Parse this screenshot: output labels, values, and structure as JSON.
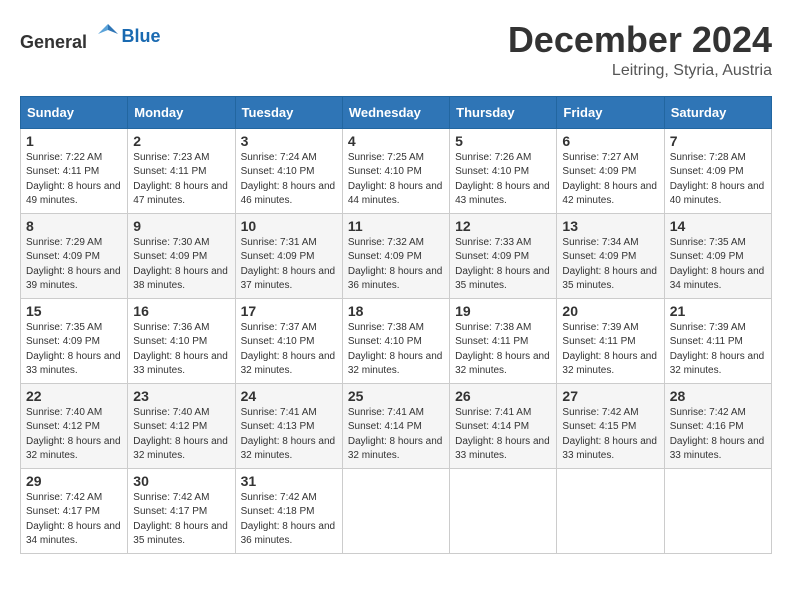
{
  "header": {
    "logo_general": "General",
    "logo_blue": "Blue",
    "month": "December 2024",
    "location": "Leitring, Styria, Austria"
  },
  "weekdays": [
    "Sunday",
    "Monday",
    "Tuesday",
    "Wednesday",
    "Thursday",
    "Friday",
    "Saturday"
  ],
  "weeks": [
    [
      {
        "day": "1",
        "sunrise": "7:22 AM",
        "sunset": "4:11 PM",
        "daylight": "8 hours and 49 minutes."
      },
      {
        "day": "2",
        "sunrise": "7:23 AM",
        "sunset": "4:11 PM",
        "daylight": "8 hours and 47 minutes."
      },
      {
        "day": "3",
        "sunrise": "7:24 AM",
        "sunset": "4:10 PM",
        "daylight": "8 hours and 46 minutes."
      },
      {
        "day": "4",
        "sunrise": "7:25 AM",
        "sunset": "4:10 PM",
        "daylight": "8 hours and 44 minutes."
      },
      {
        "day": "5",
        "sunrise": "7:26 AM",
        "sunset": "4:10 PM",
        "daylight": "8 hours and 43 minutes."
      },
      {
        "day": "6",
        "sunrise": "7:27 AM",
        "sunset": "4:09 PM",
        "daylight": "8 hours and 42 minutes."
      },
      {
        "day": "7",
        "sunrise": "7:28 AM",
        "sunset": "4:09 PM",
        "daylight": "8 hours and 40 minutes."
      }
    ],
    [
      {
        "day": "8",
        "sunrise": "7:29 AM",
        "sunset": "4:09 PM",
        "daylight": "8 hours and 39 minutes."
      },
      {
        "day": "9",
        "sunrise": "7:30 AM",
        "sunset": "4:09 PM",
        "daylight": "8 hours and 38 minutes."
      },
      {
        "day": "10",
        "sunrise": "7:31 AM",
        "sunset": "4:09 PM",
        "daylight": "8 hours and 37 minutes."
      },
      {
        "day": "11",
        "sunrise": "7:32 AM",
        "sunset": "4:09 PM",
        "daylight": "8 hours and 36 minutes."
      },
      {
        "day": "12",
        "sunrise": "7:33 AM",
        "sunset": "4:09 PM",
        "daylight": "8 hours and 35 minutes."
      },
      {
        "day": "13",
        "sunrise": "7:34 AM",
        "sunset": "4:09 PM",
        "daylight": "8 hours and 35 minutes."
      },
      {
        "day": "14",
        "sunrise": "7:35 AM",
        "sunset": "4:09 PM",
        "daylight": "8 hours and 34 minutes."
      }
    ],
    [
      {
        "day": "15",
        "sunrise": "7:35 AM",
        "sunset": "4:09 PM",
        "daylight": "8 hours and 33 minutes."
      },
      {
        "day": "16",
        "sunrise": "7:36 AM",
        "sunset": "4:10 PM",
        "daylight": "8 hours and 33 minutes."
      },
      {
        "day": "17",
        "sunrise": "7:37 AM",
        "sunset": "4:10 PM",
        "daylight": "8 hours and 32 minutes."
      },
      {
        "day": "18",
        "sunrise": "7:38 AM",
        "sunset": "4:10 PM",
        "daylight": "8 hours and 32 minutes."
      },
      {
        "day": "19",
        "sunrise": "7:38 AM",
        "sunset": "4:11 PM",
        "daylight": "8 hours and 32 minutes."
      },
      {
        "day": "20",
        "sunrise": "7:39 AM",
        "sunset": "4:11 PM",
        "daylight": "8 hours and 32 minutes."
      },
      {
        "day": "21",
        "sunrise": "7:39 AM",
        "sunset": "4:11 PM",
        "daylight": "8 hours and 32 minutes."
      }
    ],
    [
      {
        "day": "22",
        "sunrise": "7:40 AM",
        "sunset": "4:12 PM",
        "daylight": "8 hours and 32 minutes."
      },
      {
        "day": "23",
        "sunrise": "7:40 AM",
        "sunset": "4:12 PM",
        "daylight": "8 hours and 32 minutes."
      },
      {
        "day": "24",
        "sunrise": "7:41 AM",
        "sunset": "4:13 PM",
        "daylight": "8 hours and 32 minutes."
      },
      {
        "day": "25",
        "sunrise": "7:41 AM",
        "sunset": "4:14 PM",
        "daylight": "8 hours and 32 minutes."
      },
      {
        "day": "26",
        "sunrise": "7:41 AM",
        "sunset": "4:14 PM",
        "daylight": "8 hours and 33 minutes."
      },
      {
        "day": "27",
        "sunrise": "7:42 AM",
        "sunset": "4:15 PM",
        "daylight": "8 hours and 33 minutes."
      },
      {
        "day": "28",
        "sunrise": "7:42 AM",
        "sunset": "4:16 PM",
        "daylight": "8 hours and 33 minutes."
      }
    ],
    [
      {
        "day": "29",
        "sunrise": "7:42 AM",
        "sunset": "4:17 PM",
        "daylight": "8 hours and 34 minutes."
      },
      {
        "day": "30",
        "sunrise": "7:42 AM",
        "sunset": "4:17 PM",
        "daylight": "8 hours and 35 minutes."
      },
      {
        "day": "31",
        "sunrise": "7:42 AM",
        "sunset": "4:18 PM",
        "daylight": "8 hours and 36 minutes."
      },
      null,
      null,
      null,
      null
    ]
  ]
}
